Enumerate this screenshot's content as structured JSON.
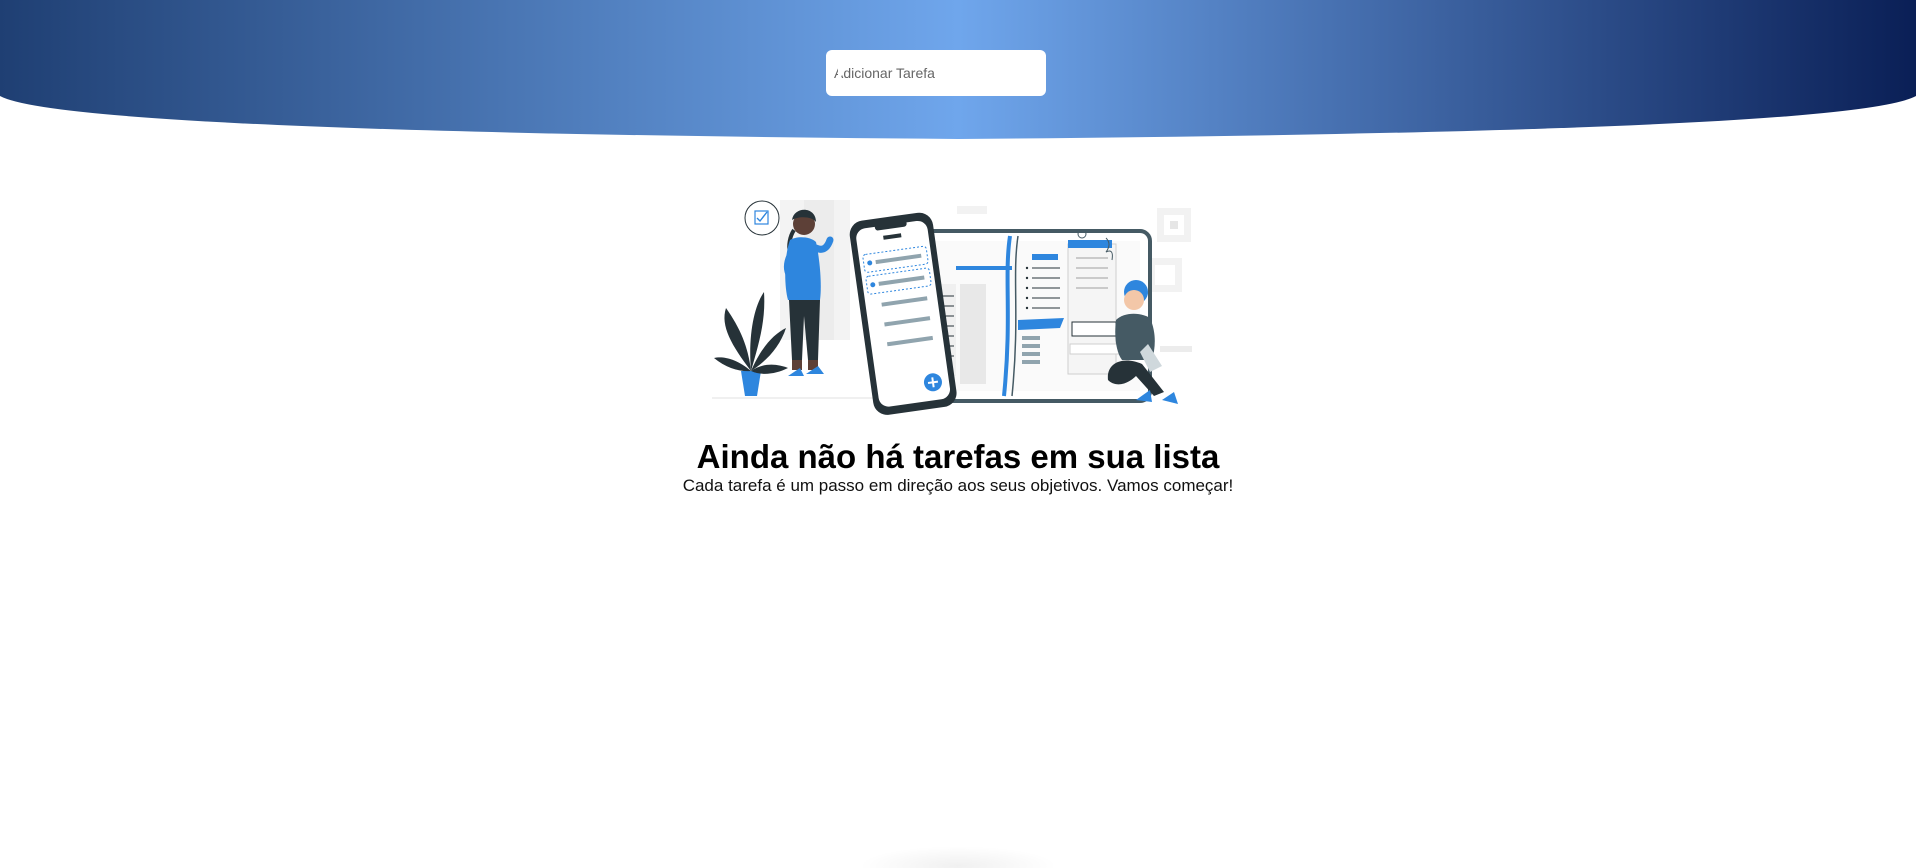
{
  "header": {
    "gradient_colors": [
      "#1f3f73",
      "#6fa6ec",
      "#0a1f56"
    ]
  },
  "add_task": {
    "placeholder": "Adicionar Tarefa",
    "value": "",
    "button_icon": "plus-icon",
    "button_color": "#ffffff"
  },
  "empty_state": {
    "illustration": "task-list-illustration",
    "title": "Ainda não há tarefas em sua lista",
    "subtitle": "Cada tarefa é um passo em direção aos seus objetivos. Vamos começar!",
    "accent_color": "#2e86de"
  }
}
